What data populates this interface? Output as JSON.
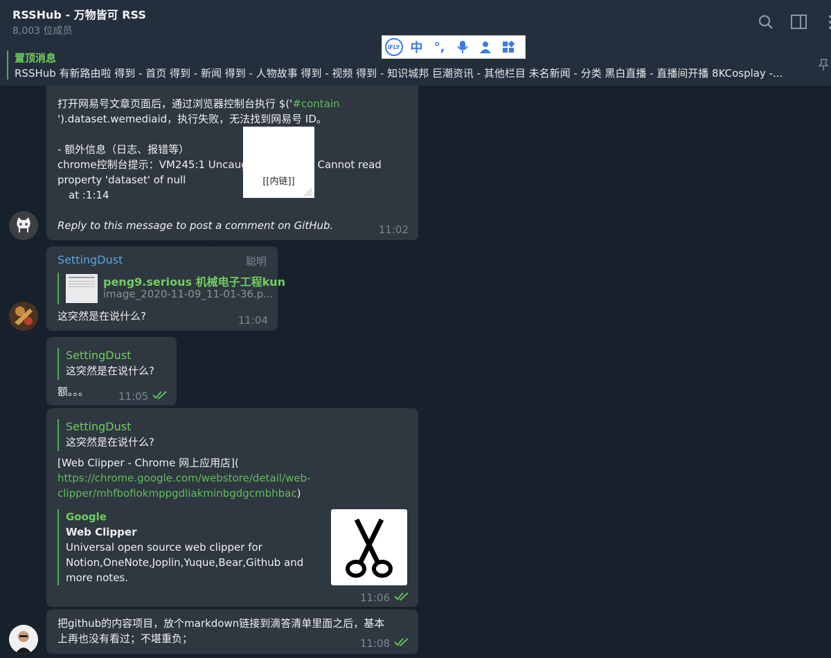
{
  "header": {
    "title": "RSSHub - 万物皆可 RSS",
    "members": "8,003 位成员",
    "icons": [
      "search-icon",
      "sidebar-icon",
      "more-icon"
    ]
  },
  "ime_bar": {
    "logo": "iFLY",
    "items": [
      "中",
      "°,",
      "mic-icon",
      "user-icon",
      "apps-icon"
    ]
  },
  "pinned": {
    "title": "置顶消息",
    "text": "RSSHub 有新路由啦 得到 - 首页 得到 - 新闻 得到 - 人物故事 得到 - 视频 得到 - 知识城邦 巨潮资讯 - 其他栏目 未名新闻 - 分类 黑白直播 - 直播间开播 8KCosplay -..."
  },
  "messages": {
    "m1": {
      "line1_a": "打开网易号文章页面后，通过浏览器控制台执行 $('",
      "line1_code": "#contain",
      "line2": "').dataset.wemediaid，执行失败，无法找到网易号 ID。",
      "line3": "- 额外信息（日志、报错等）",
      "line4": "chrome控制台提示：VM245:1 Uncaught TypeError: Cannot read",
      "line5": "property 'dataset' of null",
      "line6": "at :1:14",
      "line7": "Reply to this message to post a comment on GitHub.",
      "time": "11:02",
      "float_label": "[[内链]]"
    },
    "m2": {
      "sender": "SettingDust",
      "role": "聪明",
      "reply_name": "peng9.serious 机械电子工程kun",
      "reply_text": "image_2020-11-09_11-01-36.p...",
      "text": "这突然是在说什么?",
      "time": "11:04"
    },
    "m3": {
      "quote_name": "SettingDust",
      "quote_text": "这突然是在说什么?",
      "text": "额。。。",
      "time": "11:05"
    },
    "m4": {
      "quote_name": "SettingDust",
      "quote_text": "这突然是在说什么?",
      "line1": "[Web Clipper - Chrome 网上应用店](",
      "link1": "https://chrome.google.com/webstore/detail/web-",
      "link2": "clipper/mhfbofiokmppgdliakminbgdgcmbhbac",
      "link_close": ")",
      "preview_site": "Google",
      "preview_title": "Web Clipper",
      "preview_desc": "Universal open source web clipper for Notion,OneNote,Joplin,Yuque,Bear,Github and more notes.",
      "time": "11:06"
    },
    "m5": {
      "line1": "把github的内容项目，放个markdown链接到滴答清单里面之后，基本",
      "line2": "上再也没有看过；不堪重负；",
      "time": "11:08"
    }
  },
  "colors": {
    "background": "#17212b",
    "bubble": "#2f3740",
    "accent_green": "#6fcf5f",
    "sender_blue": "#58a6e0",
    "muted": "#7a8691"
  }
}
